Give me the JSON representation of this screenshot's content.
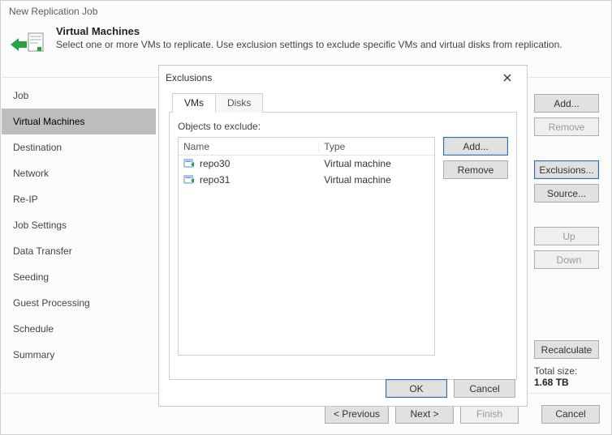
{
  "window_title": "New Replication Job",
  "step": {
    "title": "Virtual Machines",
    "description": "Select one or more VMs to replicate. Use exclusion settings to exclude specific VMs and virtual disks from replication."
  },
  "sidebar": {
    "items": [
      {
        "label": "Job"
      },
      {
        "label": "Virtual Machines"
      },
      {
        "label": "Destination"
      },
      {
        "label": "Network"
      },
      {
        "label": "Re-IP"
      },
      {
        "label": "Job Settings"
      },
      {
        "label": "Data Transfer"
      },
      {
        "label": "Seeding"
      },
      {
        "label": "Guest Processing"
      },
      {
        "label": "Schedule"
      },
      {
        "label": "Summary"
      }
    ],
    "active_index": 1
  },
  "right_buttons": {
    "add": "Add...",
    "remove": "Remove",
    "exclusions": "Exclusions...",
    "source": "Source...",
    "up": "Up",
    "down": "Down",
    "recalculate": "Recalculate"
  },
  "totals": {
    "label": "Total size:",
    "value": "1.68 TB"
  },
  "footer": {
    "previous": "< Previous",
    "next": "Next >",
    "finish": "Finish",
    "cancel": "Cancel"
  },
  "modal": {
    "title": "Exclusions",
    "tabs": {
      "vms": "VMs",
      "disks": "Disks",
      "active_index": 0
    },
    "objects_label": "Objects to exclude:",
    "columns": {
      "name": "Name",
      "type": "Type"
    },
    "rows": [
      {
        "name": "repo30",
        "type": "Virtual machine"
      },
      {
        "name": "repo31",
        "type": "Virtual machine"
      }
    ],
    "side": {
      "add": "Add...",
      "remove": "Remove"
    },
    "footer": {
      "ok": "OK",
      "cancel": "Cancel"
    }
  }
}
